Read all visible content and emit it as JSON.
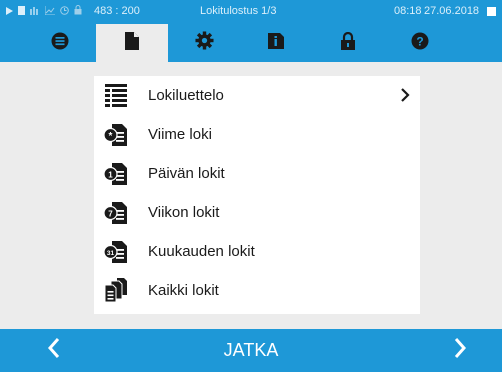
{
  "status": {
    "coords": "483 : 200",
    "title": "Lokitulostus 1/3",
    "time": "08:18",
    "date": "27.06.2018"
  },
  "tabs": [
    {
      "name": "menu",
      "icon": "list-circle-icon"
    },
    {
      "name": "logs",
      "icon": "document-icon",
      "active": true
    },
    {
      "name": "settings",
      "icon": "gear-icon"
    },
    {
      "name": "info",
      "icon": "info-tablet-icon"
    },
    {
      "name": "lock",
      "icon": "padlock-icon"
    },
    {
      "name": "help",
      "icon": "help-circle-icon"
    }
  ],
  "menu": {
    "items": [
      {
        "label": "Lokiluettelo",
        "icon": "table-list-icon",
        "has_arrow": true
      },
      {
        "label": "Viime loki",
        "icon": "doc-star-icon"
      },
      {
        "label": "Päivän lokit",
        "icon": "doc-1-icon"
      },
      {
        "label": "Viikon lokit",
        "icon": "doc-7-icon"
      },
      {
        "label": "Kuukauden lokit",
        "icon": "doc-31-icon"
      },
      {
        "label": "Kaikki lokit",
        "icon": "doc-stack-icon"
      }
    ]
  },
  "footer": {
    "continue_label": "JATKA"
  },
  "colors": {
    "accent": "#1e98d7",
    "background": "#ececec",
    "icon_dark": "#1a1a1a"
  }
}
